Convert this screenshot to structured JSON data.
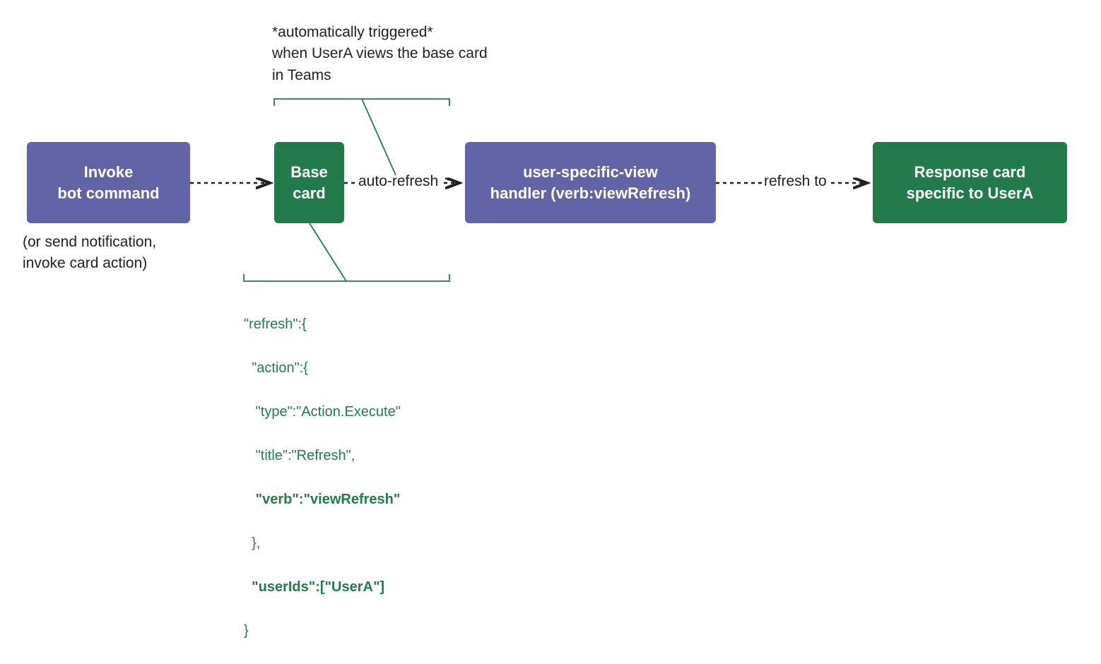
{
  "nodes": {
    "invoke": {
      "line1": "Invoke",
      "line2": "bot command"
    },
    "base": {
      "line1": "Base",
      "line2": "card"
    },
    "handler": {
      "line1": "user-specific-view",
      "line2": "handler (verb:viewRefresh)"
    },
    "response": {
      "line1": "Response card",
      "line2": "specific to UserA"
    }
  },
  "captions": {
    "invoke_sub": "(or send notification,\ninvoke card action)",
    "trigger": "*automatically triggered*\nwhen UserA views the base card\nin Teams"
  },
  "edges": {
    "auto_refresh": "auto-refresh",
    "refresh_to": "refresh to"
  },
  "json_annotation": {
    "l1": "\"refresh\":{",
    "l2": "  \"action\":{",
    "l3": "   \"type\":\"Action.Execute\"",
    "l4": "   \"title\":\"Refresh\",",
    "l5pre": "   ",
    "l5bold": "\"verb\":\"viewRefresh\"",
    "l6": "  },",
    "l7pre": "  ",
    "l7bold": "\"userIds\":[\"UserA\"]",
    "l8": "}"
  },
  "colors": {
    "purple": "#6264a7",
    "green": "#237b4b",
    "text": "#201f1e"
  }
}
